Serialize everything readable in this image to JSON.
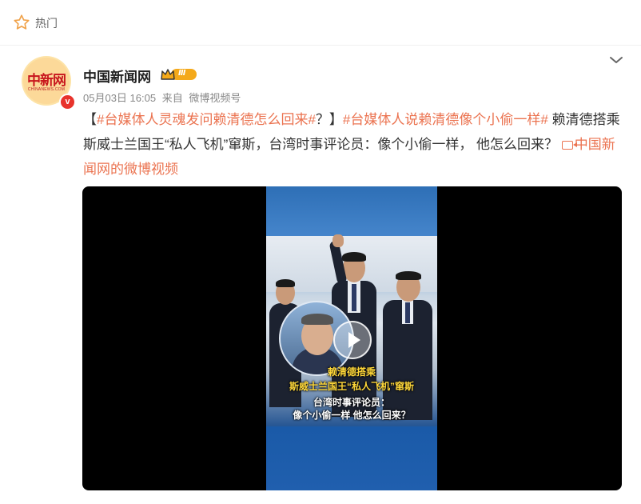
{
  "header": {
    "hot_label": "热门",
    "star_icon": "star-icon"
  },
  "post": {
    "author": "中国新闻网",
    "avatar_logo": "中新网",
    "avatar_sub": "CHINANEWS.COM",
    "verified_mark": "v",
    "level_badge": "Ⅲ",
    "date": "05月03日 16:05",
    "source_prefix": "来自",
    "source": "微博视频号",
    "text": {
      "bracket_open": "【",
      "tag1": "#台媒体人灵魂发问赖清德怎么回来#",
      "q": "？",
      "bracket_close": "】",
      "tag2": "#台媒体人说赖清德像个小偷一样#",
      "body": " 赖清德搭乘斯威士兰国王“私人飞机”窜斯，台湾时事评论员：像个小偷一样， 他怎么回来？",
      "link": "中国新闻网的微博视频"
    },
    "video": {
      "caption_line1": "赖清德搭乘",
      "caption_line2": "斯威士兰国王“私人飞机”窜斯",
      "caption_line3": "台湾时事评论员：",
      "caption_line4": "像个小偷一样 他怎么回来？"
    }
  },
  "colors": {
    "accent": "#eb7350",
    "verified": "#e8332c",
    "badge": "#f4a91a"
  }
}
